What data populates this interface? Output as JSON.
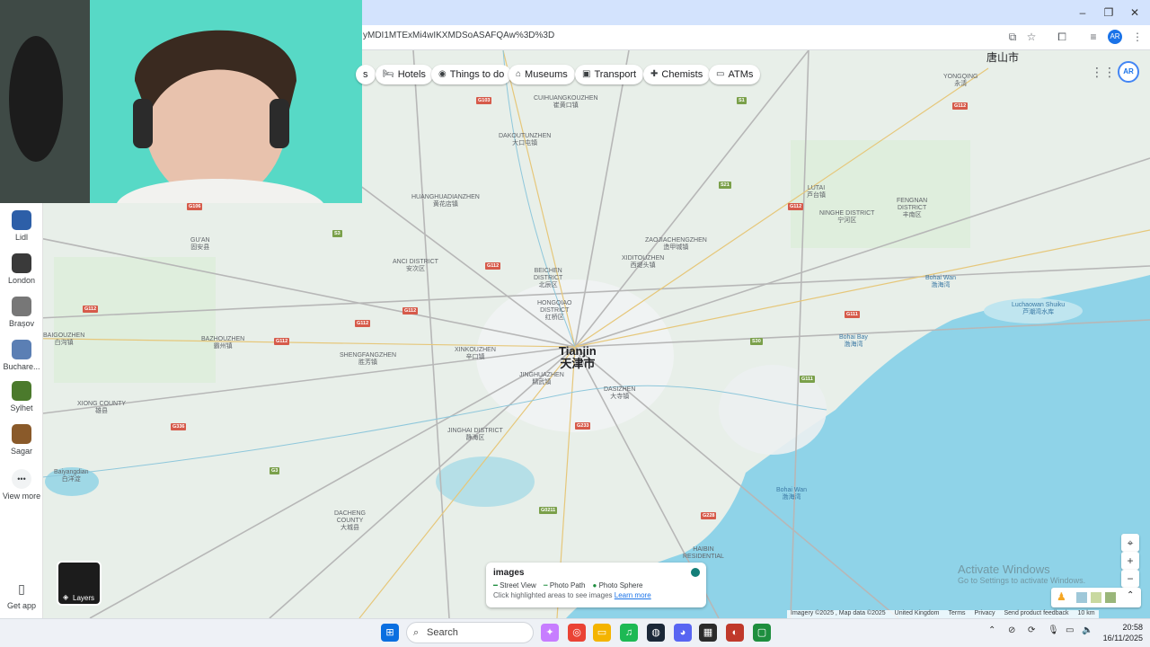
{
  "browser": {
    "url": "yMDI1MTExMi4wIKXMDSoASAFQAw%3D%3D",
    "controls": {
      "minimize": "–",
      "restore": "❐",
      "close": "✕"
    }
  },
  "chips": [
    {
      "label": "s",
      "icon": ""
    },
    {
      "label": "Hotels",
      "icon": "hotel-icon"
    },
    {
      "label": "Things to do",
      "icon": "camera-icon"
    },
    {
      "label": "Museums",
      "icon": "museum-icon"
    },
    {
      "label": "Transport",
      "icon": "transport-icon"
    },
    {
      "label": "Chemists",
      "icon": "chemist-icon"
    },
    {
      "label": "ATMs",
      "icon": "atm-icon"
    }
  ],
  "rail": {
    "items": [
      {
        "label": "Lidl",
        "color": "#2d5fa8"
      },
      {
        "label": "London",
        "color": "#3a3a3a"
      },
      {
        "label": "Brașov",
        "color": "#777777"
      },
      {
        "label": "Buchare...",
        "color": "#5b7fb4"
      },
      {
        "label": "Sylhet",
        "color": "#4b7a2c"
      },
      {
        "label": "Sagar",
        "color": "#8a5a2a"
      }
    ],
    "view_more": "View more",
    "get_app": "Get app"
  },
  "map": {
    "city_labels": [
      {
        "en": "Tianjin",
        "zh": "天津市"
      },
      {
        "en": "",
        "zh": "唐山市"
      }
    ],
    "districts": [
      "CUIHUANGKOUZHEN",
      "DAKOUTUNZHEN",
      "HUANGHUADIANZHEN",
      "ANCI DISTRICT",
      "BEICHEN DISTRICT",
      "HONGQIAO DISTRICT",
      "XINKOUZHEN",
      "JINGHUAZHEN",
      "DASIZHEN",
      "JINGHAI DISTRICT",
      "BAZHOUZHEN",
      "SHENGFANGZHEN",
      "BAIGOUZHEN",
      "XIONG COUNTY",
      "GUAN",
      "DACHENG COUNTY",
      "XIDITOUZHEN",
      "ZAOJIACHENGZHEN",
      "LUTAI",
      "NINGHE DISTRICT",
      "FENGNAN DISTRICT",
      "YONGQING",
      "Baiyangdian",
      "Bohai Bay",
      "Bohai Wan",
      "Luchaowan Shuiku",
      "HAIBIN RESIDENTIAL"
    ]
  },
  "images_card": {
    "title": "images",
    "legend": [
      "Street View",
      "Photo Path",
      "Photo Sphere"
    ],
    "hint": "Click highlighted areas to see images",
    "link": "Learn more"
  },
  "layers_label": "Layers",
  "attribution": [
    "Imagery ©2025 , Map data ©2025",
    "United Kingdom",
    "Terms",
    "Privacy",
    "Send product feedback",
    "10 km"
  ],
  "watermark": {
    "line1": "Activate Windows",
    "line2": "Go to Settings to activate Windows."
  },
  "taskbar": {
    "search_placeholder": "Search",
    "time": "20:58",
    "date": "16/11/2025"
  },
  "avatar_initials": "AR"
}
